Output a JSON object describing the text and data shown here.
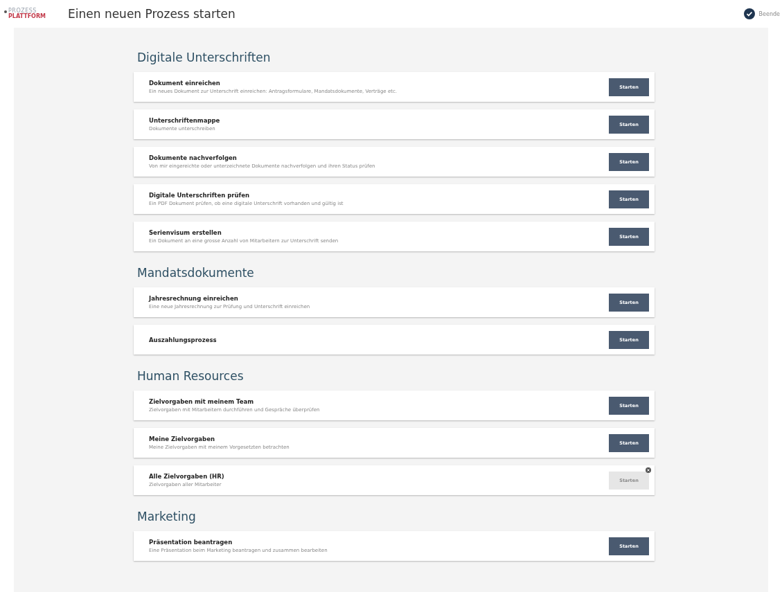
{
  "header": {
    "logo_top": "PROZESS",
    "logo_bottom": "PLATTFORM",
    "title": "Einen neuen Prozess starten",
    "user_action": "Beende"
  },
  "sections": [
    {
      "title": "Digitale Unterschriften",
      "items": [
        {
          "name": "Dokument einreichen",
          "description": "Ein neues Dokument zur Unterschrift einreichen: Antragsformulare, Mandatsdokumente, Verträge etc.",
          "button": "Starten",
          "disabled": false
        },
        {
          "name": "Unterschriftenmappe",
          "description": "Dokumente unterschreiben",
          "button": "Starten",
          "disabled": false
        },
        {
          "name": "Dokumente nachverfolgen",
          "description": "Von mir eingereichte oder unterzeichnete Dokumente nachverfolgen und ihren Status prüfen",
          "button": "Starten",
          "disabled": false
        },
        {
          "name": "Digitale Unterschriften prüfen",
          "description": "Ein PDF Dokument prüfen, ob eine digitale Unterschrift vorhanden und gültig ist",
          "button": "Starten",
          "disabled": false
        },
        {
          "name": "Serienvisum erstellen",
          "description": "Ein Dokument an eine grosse Anzahl von Mitarbeitern zur Unterschrift senden",
          "button": "Starten",
          "disabled": false
        }
      ]
    },
    {
      "title": "Mandatsdokumente",
      "items": [
        {
          "name": "Jahresrechnung einreichen",
          "description": "Eine neue Jahresrechnung zur Prüfung und Unterschrift einreichen",
          "button": "Starten",
          "disabled": false
        },
        {
          "name": "Auszahlungsprozess",
          "button": "Starten",
          "disabled": false
        }
      ]
    },
    {
      "title": "Human Resources",
      "items": [
        {
          "name": "Zielvorgaben mit meinem Team",
          "description": "Zielvorgaben mit Mitarbeitern durchführen und Gespräche überprüfen",
          "button": "Starten",
          "disabled": false
        },
        {
          "name": "Meine Zielvorgaben",
          "description": "Meine Zielvorgaben mit meinem Vorgesetzten betrachten",
          "button": "Starten",
          "disabled": false
        },
        {
          "name": "Alle Zielvorgaben (HR)",
          "description": "Zielvorgaben aller Mitarbeiter",
          "button": "Starten",
          "disabled": true
        }
      ]
    },
    {
      "title": "Marketing",
      "items": [
        {
          "name": "Präsentation beantragen",
          "description": "Eine Präsentation beim Marketing beantragen und zusammen bearbeiten",
          "button": "Starten",
          "disabled": false
        }
      ]
    }
  ]
}
